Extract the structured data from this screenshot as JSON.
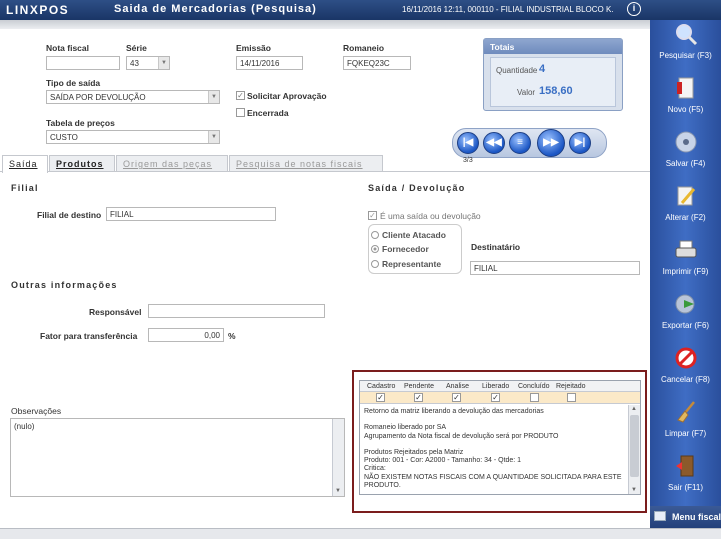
{
  "titlebar": {
    "logo": "LINXPOS",
    "title": "Saida de Mercadorias (Pesquisa)",
    "info": "16/11/2016 12:11, 000110 - FILIAL INDUSTRIAL BLOCO K.",
    "info_icon": "i"
  },
  "header": {
    "nota_fiscal_label": "Nota fiscal",
    "nota_fiscal_value": "",
    "serie_label": "Série",
    "serie_value": "43",
    "emissao_label": "Emissão",
    "emissao_value": "14/11/2016",
    "romaneio_label": "Romaneio",
    "romaneio_value": "FQKEQ23C",
    "tipo_saida_label": "Tipo de saída",
    "tipo_saida_value": "SAÍDA POR DEVOLUÇÃO",
    "solicitar_aprovacao_label": "Solicitar Aprovação",
    "solicitar_aprovacao_checked": true,
    "encerrada_label": "Encerrada",
    "encerrada_checked": false,
    "tabela_precos_label": "Tabela de preços",
    "tabela_precos_value": "CUSTO"
  },
  "totals": {
    "title": "Totais",
    "quantidade_label": "Quantidade",
    "quantidade_value": "4",
    "valor_label": "Valor",
    "valor_value": "158,60"
  },
  "nav": {
    "record_position": "3/3"
  },
  "tabs": [
    {
      "label": "Saída",
      "active": true
    },
    {
      "label": "Produtos",
      "active": false
    },
    {
      "label": "Origem das peças",
      "active": false
    },
    {
      "label": "Pesquisa de notas fiscais",
      "active": false
    }
  ],
  "filial": {
    "section_title": "Filial",
    "destino_label": "Filial de destino",
    "destino_value": "FILIAL"
  },
  "saida_devolucao": {
    "section_title": "Saída / Devolução",
    "e_saida_label": "É uma saída ou devolução",
    "e_saida_checked": true,
    "radios": [
      {
        "label": "Cliente Atacado",
        "selected": false
      },
      {
        "label": "Fornecedor",
        "selected": true
      },
      {
        "label": "Representante",
        "selected": false
      }
    ],
    "destinatario_label": "Destinatário",
    "destinatario_value": "FILIAL"
  },
  "outras": {
    "section_title": "Outras informações",
    "responsavel_label": "Responsável",
    "responsavel_value": "",
    "fator_label": "Fator para transferência",
    "fator_value": "0,00",
    "fator_unit": "%"
  },
  "observacoes": {
    "label": "Observações",
    "value": "(nulo)"
  },
  "critica": {
    "columns": [
      "Cadastro",
      "Pendente",
      "Analise",
      "Liberado",
      "Concluído",
      "Rejeitado"
    ],
    "checks": [
      true,
      true,
      true,
      true,
      false,
      false
    ],
    "text": "Retorno da matriz liberando a devolução das mercadorias\n\nRomaneio liberado por SA\nAgrupamento da Nota fiscal de devolução será por PRODUTO\n\nProdutos Rejeitados pela Matriz\nProduto: 001 - Cor: A2000 - Tamanho: 34 - Qtde: 1\nCritica:\nNÃO EXISTEM NOTAS FISCAIS COM A QUANTIDADE SOLICITADA PARA ESTE PRODUTO."
  },
  "sidebar": [
    {
      "label": "Pesquisar (F3)",
      "icon": "search-icon"
    },
    {
      "label": "Novo (F5)",
      "icon": "new-document-icon"
    },
    {
      "label": "Salvar (F4)",
      "icon": "save-disk-icon"
    },
    {
      "label": "Alterar (F2)",
      "icon": "edit-icon"
    },
    {
      "label": "Imprimir (F9)",
      "icon": "printer-icon"
    },
    {
      "label": "Exportar (F6)",
      "icon": "export-icon"
    },
    {
      "label": "Cancelar (F8)",
      "icon": "cancel-icon"
    },
    {
      "label": "Limpar (F7)",
      "icon": "broom-icon"
    },
    {
      "label": "Sair (F11)",
      "icon": "exit-door-icon"
    }
  ],
  "menu_fiscal": "Menu fiscal"
}
